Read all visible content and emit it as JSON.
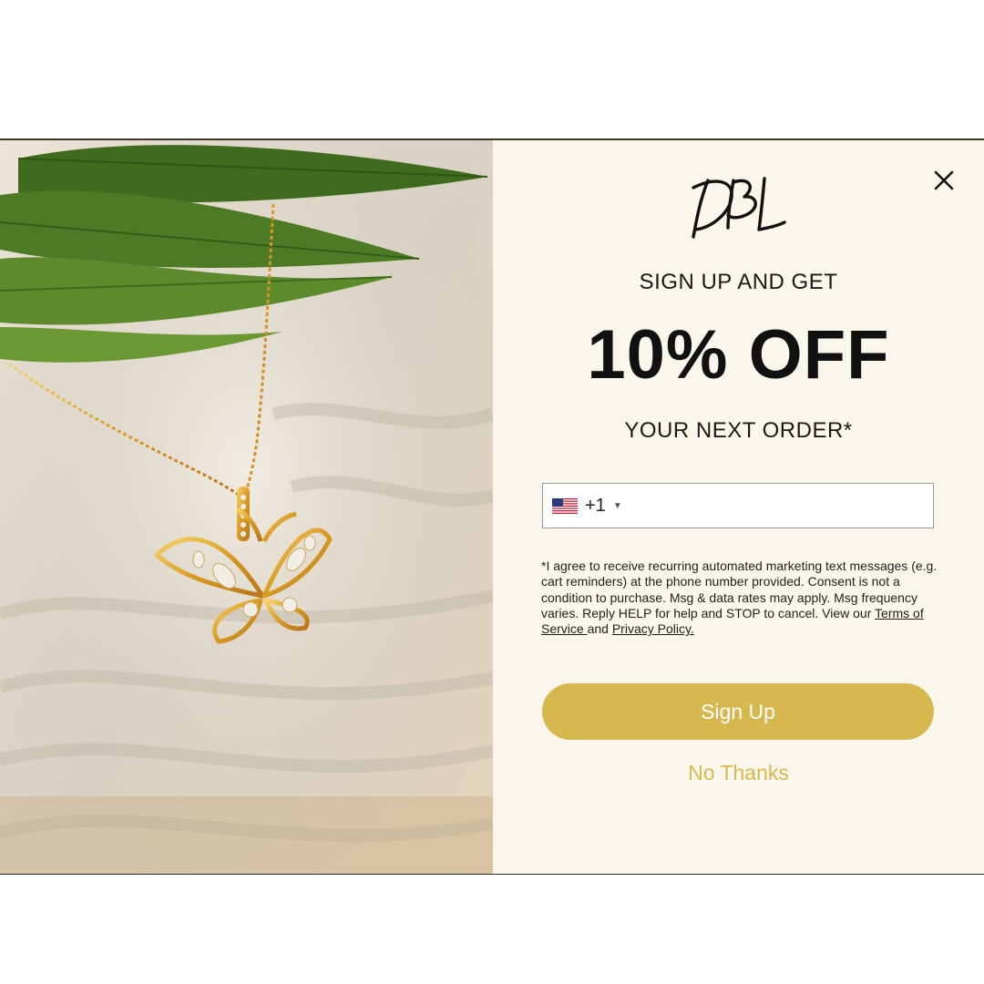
{
  "popup": {
    "brand": "DBL",
    "headline_top": "SIGN UP AND GET",
    "headline_offer": "10% OFF",
    "headline_bottom": "YOUR NEXT ORDER*",
    "phone": {
      "country_flag_icon": "us-flag-icon",
      "dial_code": "+1",
      "caret": "▼",
      "value": ""
    },
    "consent": {
      "text": "*I agree to receive recurring automated marketing text messages (e.g. cart reminders) at the phone number provided. Consent is not a condition to purchase. Msg & data rates may apply. Msg frequency varies. Reply HELP for help and STOP to cancel. View our ",
      "terms_link": "Terms of Service ",
      "joiner": "and ",
      "privacy_link": "Privacy Policy."
    },
    "signup_label": "Sign Up",
    "nothanks_label": "No Thanks",
    "close_icon": "close-icon"
  },
  "colors": {
    "accent": "#d6b84e",
    "panel_bg": "#faf6ec",
    "text": "#111111"
  }
}
